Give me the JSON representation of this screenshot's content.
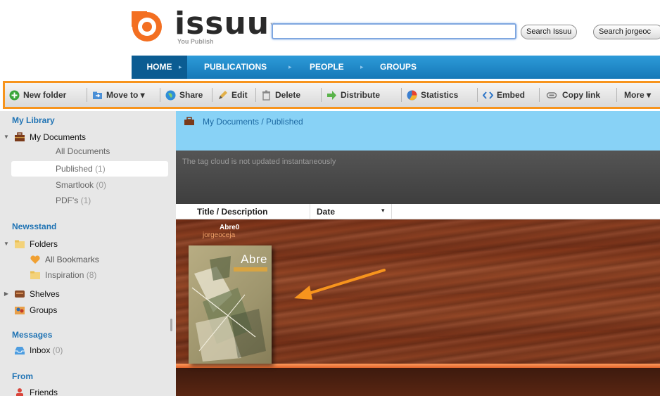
{
  "header": {
    "logo_text": "issuu",
    "logo_tm": "™",
    "logo_tagline": "You Publish",
    "search_value": "",
    "search_issuu_label": "Search Issuu",
    "search_user_label": "Search jorgeoc"
  },
  "nav": {
    "items": [
      "HOME",
      "PUBLICATIONS",
      "PEOPLE",
      "GROUPS"
    ],
    "separator": "▸",
    "active": "HOME"
  },
  "toolbar": {
    "new_folder": "New folder",
    "move_to": "Move to ▾",
    "share": "Share",
    "edit": "Edit",
    "delete": "Delete",
    "distribute": "Distribute",
    "statistics": "Statistics",
    "embed": "Embed",
    "copy_link": "Copy link",
    "more": "More ▾",
    "highlight_color": "#f7941d"
  },
  "sidebar": {
    "my_library": "My Library",
    "my_documents": "My Documents",
    "docs": [
      {
        "label": "All Documents",
        "count": ""
      },
      {
        "label": "Published",
        "count": "(1)"
      },
      {
        "label": "Smartlook",
        "count": "(0)"
      },
      {
        "label": "PDF's",
        "count": "(1)"
      }
    ],
    "selected": "Published",
    "newsstand": "Newsstand",
    "folders": "Folders",
    "all_bookmarks": "All Bookmarks",
    "inspiration": "Inspiration",
    "inspiration_count": "(8)",
    "shelves": "Shelves",
    "groups": "Groups",
    "messages": "Messages",
    "inbox": "Inbox",
    "inbox_count": "(0)",
    "from": "From",
    "friends": "Friends"
  },
  "main": {
    "breadcrumb": "My Documents / Published",
    "tag_cloud_note": "The tag cloud is not updated instantaneously",
    "col_title": "Title / Description",
    "col_date": "Date",
    "col_date_caret": "▾",
    "publication": {
      "title": "Abre0",
      "author": "jorgeoceja",
      "cover_word": "Abre"
    },
    "arrow_color": "#f7941d"
  },
  "colors": {
    "brand_orange": "#f7941d",
    "nav_blue": "#1678b7",
    "link_blue": "#1f73b4",
    "breadcrumb_bg": "#88d2f6"
  }
}
